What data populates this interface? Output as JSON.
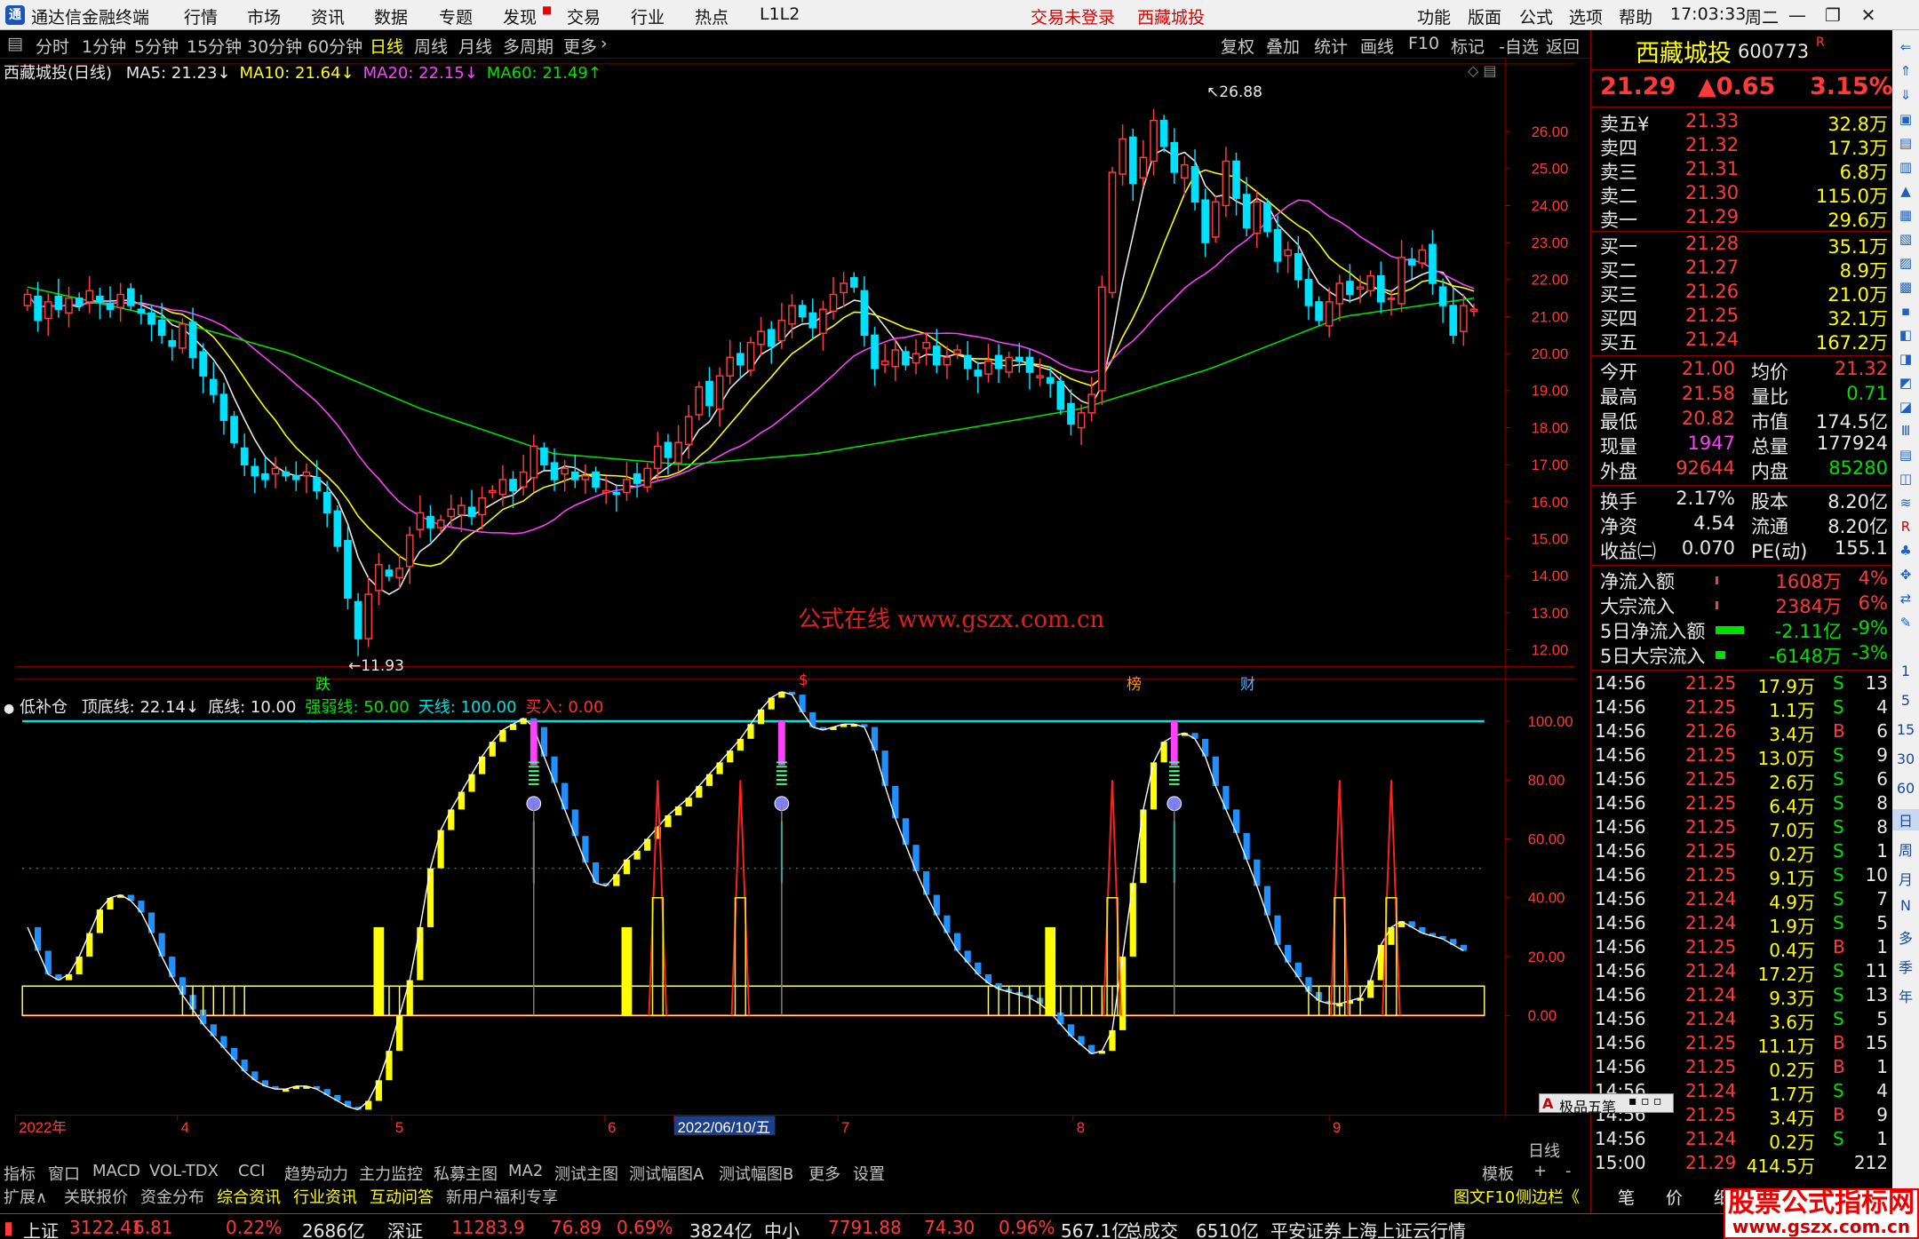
{
  "app": {
    "title": "通达信金融终端",
    "menu": [
      "行情",
      "市场",
      "资讯",
      "数据",
      "专题",
      "发现",
      "交易",
      "行业",
      "热点",
      "L1L2"
    ],
    "center_links": [
      "交易未登录",
      "西藏城投"
    ],
    "right_menu": [
      "功能",
      "版面",
      "公式",
      "选项",
      "帮助"
    ],
    "clock": "17:03:33",
    "weekday": "周二"
  },
  "toolbar": {
    "periods": [
      "分时",
      "1分钟",
      "5分钟",
      "15分钟",
      "30分钟",
      "60分钟",
      "日线",
      "周线",
      "月线",
      "多周期",
      "更多"
    ],
    "active_period": "日线",
    "right_buttons": [
      "复权",
      "叠加",
      "统计",
      "画线",
      "F10",
      "标记",
      "-自选",
      "返回"
    ]
  },
  "main_chart": {
    "title": "西藏城投(日线)",
    "ma_legend": [
      {
        "label": "MA5: 21.23",
        "arrow": "↓",
        "color": "#e8e8e8"
      },
      {
        "label": "MA10: 21.64",
        "arrow": "↓",
        "color": "#ffff00"
      },
      {
        "label": "MA20: 22.15",
        "arrow": "↓",
        "color": "#ff40ff"
      },
      {
        "label": "MA60: 21.49",
        "arrow": "↑",
        "color": "#00e000"
      }
    ],
    "high_label": "26.88",
    "low_label": "11.93",
    "watermark": "公式在线  www.gszx.com.cn",
    "event_markers": [
      {
        "text": "跌",
        "color": "#00ff00"
      },
      {
        "text": "$",
        "color": "#ff3030"
      },
      {
        "text": "榜",
        "color": "#ff9900"
      },
      {
        "text": "财",
        "color": "#4fb0ff"
      }
    ]
  },
  "sub_chart": {
    "title": "低补仓",
    "legend": [
      {
        "label": "顶底线: 22.14",
        "arrow": "↓",
        "color": "#e8e8e8"
      },
      {
        "label": "底线: 10.00",
        "arrow": "",
        "color": "#e8e8e8"
      },
      {
        "label": "强弱线: 50.00",
        "arrow": "",
        "color": "#00e000"
      },
      {
        "label": "天线: 100.00",
        "arrow": "",
        "color": "#00e0e0"
      },
      {
        "label": "买入: 0.00",
        "arrow": "",
        "color": "#ff3030"
      }
    ]
  },
  "chart_data": [
    {
      "type": "candlestick",
      "title": "西藏城投(日线)",
      "yticks": [
        "26.00",
        "25.00",
        "24.00",
        "23.00",
        "22.00",
        "21.00",
        "20.00",
        "19.00",
        "18.00",
        "17.00",
        "16.00",
        "15.00",
        "14.00",
        "13.00",
        "12.00"
      ],
      "ylim": [
        11.5,
        27.5
      ],
      "x_tick_labels": [
        "2022年",
        "4",
        "5",
        "6",
        "2022/06/10/五",
        "7",
        "8",
        "9"
      ],
      "annotations": {
        "high": 26.88,
        "low": 11.93
      },
      "closes": [
        21.6,
        20.9,
        21.4,
        21.2,
        21.5,
        21.3,
        21.7,
        21.4,
        21.2,
        21.6,
        21.3,
        21.1,
        20.8,
        20.5,
        20.2,
        20.8,
        19.9,
        19.4,
        18.9,
        18.2,
        17.6,
        17.0,
        16.7,
        16.6,
        16.9,
        16.7,
        16.6,
        16.8,
        16.3,
        15.7,
        14.8,
        13.4,
        12.3,
        13.5,
        14.3,
        14.0,
        14.2,
        15.1,
        15.7,
        15.3,
        15.5,
        15.8,
        15.9,
        15.6,
        16.1,
        16.3,
        16.6,
        16.3,
        16.8,
        17.5,
        17.0,
        16.6,
        16.9,
        16.6,
        16.7,
        16.4,
        16.3,
        16.2,
        16.6,
        16.5,
        16.9,
        17.5,
        17.2,
        17.6,
        18.3,
        19.1,
        18.6,
        19.4,
        19.9,
        19.7,
        20.3,
        20.6,
        20.2,
        20.9,
        21.3,
        21.0,
        20.7,
        21.2,
        21.6,
        21.9,
        21.8,
        20.5,
        19.6,
        19.8,
        20.1,
        19.7,
        20.0,
        20.3,
        19.7,
        19.9,
        20.1,
        19.6,
        19.4,
        19.8,
        19.6,
        19.9,
        19.8,
        19.5,
        19.4,
        19.2,
        18.5,
        18.1,
        18.4,
        18.9,
        21.8,
        24.9,
        25.8,
        24.6,
        25.3,
        26.3,
        25.6,
        24.9,
        25.1,
        24.1,
        23.0,
        24.1,
        25.2,
        24.2,
        23.4,
        24.1,
        23.3,
        22.5,
        22.8,
        22.0,
        21.3,
        20.9,
        21.4,
        21.9,
        21.6,
        21.8,
        22.1,
        21.4,
        21.5,
        22.6,
        22.4,
        22.8,
        21.9,
        21.3,
        20.5,
        21.3,
        21.2
      ]
    },
    {
      "type": "line",
      "title": "低补仓",
      "yticks": [
        "100.00",
        "80.00",
        "60.00",
        "40.00",
        "20.00",
        "0.00"
      ],
      "ylim": [
        -30,
        115
      ],
      "series": [
        {
          "name": "顶底线",
          "color": "#ffff00",
          "values": [
            30,
            22,
            14,
            12,
            14,
            20,
            28,
            36,
            40,
            41,
            39,
            35,
            28,
            20,
            13,
            7,
            2,
            -3,
            -7,
            -11,
            -15,
            -19,
            -22,
            -24,
            -25,
            -25,
            -24,
            -24,
            -25,
            -27,
            -29,
            -31,
            -32,
            -29,
            -22,
            -12,
            0,
            12,
            30,
            50,
            63,
            70,
            76,
            82,
            88,
            93,
            97,
            99,
            101,
            98,
            88,
            79,
            70,
            61,
            52,
            45,
            44,
            48,
            53,
            56,
            60,
            64,
            68,
            71,
            74,
            78,
            82,
            86,
            90,
            94,
            99,
            104,
            108,
            110,
            109,
            103,
            98,
            97,
            98,
            99,
            99,
            98,
            90,
            78,
            67,
            58,
            49,
            41,
            34,
            28,
            22,
            18,
            14,
            11,
            9,
            8,
            7,
            6,
            4,
            1,
            -3,
            -7,
            -10,
            -13,
            -12,
            -5,
            20,
            45,
            70,
            86,
            93,
            95,
            96,
            94,
            88,
            78,
            70,
            62,
            53,
            44,
            34,
            24,
            18,
            13,
            8,
            5,
            4,
            4,
            5,
            6,
            12,
            24,
            30,
            32,
            30,
            28,
            27,
            26,
            24,
            22
          ]
        },
        {
          "name": "底线",
          "color": "#e8e8e8",
          "values": [
            10
          ]
        },
        {
          "name": "强弱线",
          "color": "#00e000",
          "values": [
            50
          ]
        },
        {
          "name": "天线",
          "color": "#00e0e0",
          "values": [
            100
          ]
        },
        {
          "name": "买入",
          "color": "#ff3030",
          "values": [
            0
          ]
        }
      ]
    }
  ],
  "quote": {
    "name": "西藏城投",
    "code": "600773",
    "flag": "R",
    "price": "21.29",
    "change": "▲0.65",
    "pct": "3.15%",
    "asks": [
      {
        "label": "卖五",
        "mark": "¥",
        "price": "21.33",
        "vol": "32.8万"
      },
      {
        "label": "卖四",
        "mark": "",
        "price": "21.32",
        "vol": "17.3万"
      },
      {
        "label": "卖三",
        "mark": "",
        "price": "21.31",
        "vol": "6.8万"
      },
      {
        "label": "卖二",
        "mark": "",
        "price": "21.30",
        "vol": "115.0万"
      },
      {
        "label": "卖一",
        "mark": "",
        "price": "21.29",
        "vol": "29.6万"
      }
    ],
    "bids": [
      {
        "label": "买一",
        "price": "21.28",
        "vol": "35.1万"
      },
      {
        "label": "买二",
        "price": "21.27",
        "vol": "8.9万"
      },
      {
        "label": "买三",
        "price": "21.26",
        "vol": "21.0万"
      },
      {
        "label": "买四",
        "price": "21.25",
        "vol": "32.1万"
      },
      {
        "label": "买五",
        "price": "21.24",
        "vol": "167.2万"
      }
    ],
    "stats1": [
      {
        "l1": "今开",
        "v1": "21.00",
        "c1": "#ff3a3a",
        "l2": "均价",
        "v2": "21.32",
        "c2": "#ff3a3a"
      },
      {
        "l1": "最高",
        "v1": "21.58",
        "c1": "#ff3a3a",
        "l2": "量比",
        "v2": "0.71",
        "c2": "#00e000"
      },
      {
        "l1": "最低",
        "v1": "20.82",
        "c1": "#ff3a3a",
        "l2": "市值",
        "v2": "174.5亿",
        "c2": "#e8e8e8"
      },
      {
        "l1": "现量",
        "v1": "1947",
        "c1": "#ff40ff",
        "l2": "总量",
        "v2": "177924",
        "c2": "#e8e8e8"
      },
      {
        "l1": "外盘",
        "v1": "92644",
        "c1": "#ff3a3a",
        "l2": "内盘",
        "v2": "85280",
        "c2": "#00e000"
      }
    ],
    "stats2": [
      {
        "l1": "换手",
        "v1": "2.17%",
        "c1": "#e8e8e8",
        "l2": "股本",
        "v2": "8.20亿",
        "c2": "#e8e8e8"
      },
      {
        "l1": "净资",
        "v1": "4.54",
        "c1": "#e8e8e8",
        "l2": "流通",
        "v2": "8.20亿",
        "c2": "#e8e8e8"
      },
      {
        "l1": "收益㈡",
        "v1": "0.070",
        "c1": "#e8e8e8",
        "l2": "PE(动)",
        "v2": "155.1",
        "c2": "#e8e8e8"
      }
    ],
    "flows": [
      {
        "label": "净流入额",
        "value": "1608万",
        "pct": "4%",
        "color": "#ff3a3a",
        "bar": 0.02
      },
      {
        "label": "大宗流入",
        "value": "2384万",
        "pct": "6%",
        "color": "#ff3a3a",
        "bar": 0.02
      },
      {
        "label": "5日净流入额",
        "value": "-2.11亿",
        "pct": "-9%",
        "color": "#00e000",
        "bar": 0.9
      },
      {
        "label": "5日大宗流入",
        "value": "-6148万",
        "pct": "-3%",
        "color": "#00e000",
        "bar": 0.3
      }
    ],
    "ticks": [
      {
        "t": "14:56",
        "p": "21.25",
        "v": "17.9万",
        "s": "S",
        "n": "13"
      },
      {
        "t": "14:56",
        "p": "21.25",
        "v": "1.1万",
        "s": "S",
        "n": "4"
      },
      {
        "t": "14:56",
        "p": "21.26",
        "v": "3.4万",
        "s": "B",
        "n": "6"
      },
      {
        "t": "14:56",
        "p": "21.25",
        "v": "13.0万",
        "s": "S",
        "n": "9"
      },
      {
        "t": "14:56",
        "p": "21.25",
        "v": "2.6万",
        "s": "S",
        "n": "6"
      },
      {
        "t": "14:56",
        "p": "21.25",
        "v": "6.4万",
        "s": "S",
        "n": "8"
      },
      {
        "t": "14:56",
        "p": "21.25",
        "v": "7.0万",
        "s": "S",
        "n": "8"
      },
      {
        "t": "14:56",
        "p": "21.25",
        "v": "0.2万",
        "s": "S",
        "n": "1"
      },
      {
        "t": "14:56",
        "p": "21.25",
        "v": "9.1万",
        "s": "S",
        "n": "10"
      },
      {
        "t": "14:56",
        "p": "21.24",
        "v": "4.9万",
        "s": "S",
        "n": "7"
      },
      {
        "t": "14:56",
        "p": "21.24",
        "v": "1.9万",
        "s": "S",
        "n": "5"
      },
      {
        "t": "14:56",
        "p": "21.25",
        "v": "0.4万",
        "s": "B",
        "n": "1"
      },
      {
        "t": "14:56",
        "p": "21.24",
        "v": "17.2万",
        "s": "S",
        "n": "11"
      },
      {
        "t": "14:56",
        "p": "21.24",
        "v": "9.3万",
        "s": "S",
        "n": "13"
      },
      {
        "t": "14:56",
        "p": "21.24",
        "v": "3.6万",
        "s": "S",
        "n": "5"
      },
      {
        "t": "14:56",
        "p": "21.25",
        "v": "11.1万",
        "s": "B",
        "n": "15"
      },
      {
        "t": "14:56",
        "p": "21.25",
        "v": "0.2万",
        "s": "B",
        "n": "1"
      },
      {
        "t": "14:56",
        "p": "21.24",
        "v": "1.7万",
        "s": "S",
        "n": "4"
      },
      {
        "t": "14:56",
        "p": "21.25",
        "v": "3.4万",
        "s": "B",
        "n": "9"
      },
      {
        "t": "14:56",
        "p": "21.24",
        "v": "0.2万",
        "s": "S",
        "n": "1"
      },
      {
        "t": "15:00",
        "p": "21.29",
        "v": "414.5万",
        "s": "",
        "n": "212"
      }
    ],
    "bottom_tabs": [
      "笔",
      "价",
      "细",
      "势"
    ]
  },
  "side_icons": [
    "1",
    "5",
    "15",
    "30",
    "60",
    "日",
    "周",
    "月",
    "N",
    "多",
    "季",
    "年"
  ],
  "popup": "极品五笔",
  "bottom_tabs": {
    "row1": [
      "指标",
      "窗口",
      "MACD",
      "VOL-TDX",
      "CCI",
      "趋势动力",
      "主力监控",
      "私募主图",
      "MA2",
      "测试主图",
      "测试幅图A",
      "测试幅图B",
      "更多",
      "设置"
    ],
    "row1_right": [
      "模板",
      "+",
      "-"
    ],
    "row2": [
      "扩展∧",
      "关联报价",
      "资金分布",
      "综合资讯",
      "行业资讯",
      "互动问答",
      "新用户福利专享"
    ],
    "row2_right": [
      "图文F10",
      "侧边栏《"
    ],
    "period_label": "日线"
  },
  "statusbar": {
    "items": [
      {
        "name": "上证",
        "val": "3122.41",
        "chg": "6.81",
        "pct": "0.22%",
        "amt": "2686亿"
      },
      {
        "name": "深证",
        "val": "11283.9",
        "chg": "76.89",
        "pct": "0.69%",
        "amt": "3824亿"
      },
      {
        "name": "中小",
        "val": "7791.88",
        "chg": "74.30",
        "pct": "0.96%",
        "amt": "567.1亿"
      }
    ],
    "total_label": "总成交",
    "total": "6510亿",
    "broker": "平安证券上海上证云行情"
  },
  "watermark_logo": {
    "line1": "股票公式指标网",
    "line2": "www.gszx.com.cn"
  },
  "colors": {
    "up": "#ff3a3a",
    "down": "#00e0ff",
    "ma5": "#e8e8e8",
    "ma10": "#ffff00",
    "ma20": "#ff40ff",
    "ma60": "#00e000",
    "grid": "#800000"
  }
}
